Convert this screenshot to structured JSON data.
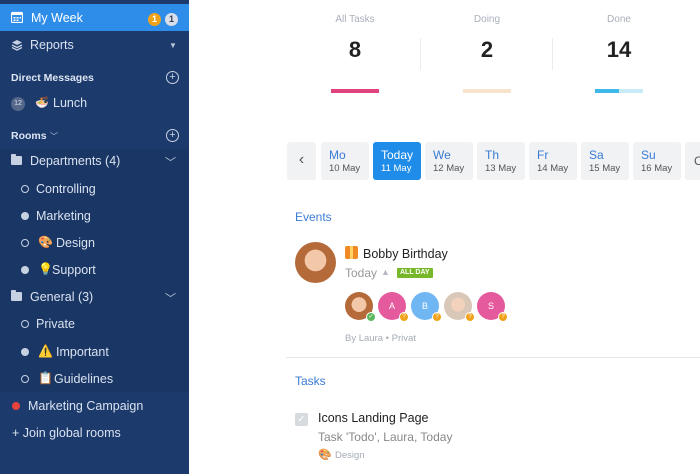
{
  "sidebar": {
    "my_week": {
      "label": "My Week",
      "badge_orange": "1",
      "badge_gray": "1"
    },
    "reports": {
      "label": "Reports"
    },
    "direct_messages": {
      "heading": "Direct Messages",
      "items": [
        {
          "count": "12",
          "emoji": "🍜",
          "label": "Lunch"
        }
      ]
    },
    "rooms": {
      "heading": "Rooms",
      "groups": [
        {
          "label": "Departments (4)",
          "items": [
            {
              "label": "Controlling",
              "status": "open"
            },
            {
              "label": "Marketing",
              "status": "full"
            },
            {
              "label": "Design",
              "status": "open",
              "emoji": "🎨"
            },
            {
              "label": "Support",
              "status": "full",
              "emoji": "💡"
            }
          ]
        },
        {
          "label": "General (3)",
          "items": [
            {
              "label": "Private",
              "status": "open"
            },
            {
              "label": "Important",
              "status": "full",
              "emoji": "⚠️"
            },
            {
              "label": "Guidelines",
              "status": "open",
              "emoji": "📋"
            }
          ]
        }
      ]
    },
    "marketing_campaign": {
      "label": "Marketing Campaign"
    },
    "join_global": {
      "label": "+ Join global rooms"
    }
  },
  "stats": [
    {
      "label": "All Tasks",
      "value": "8",
      "color": "#e0427d"
    },
    {
      "label": "Doing",
      "value": "2",
      "color": "#f7e3c9"
    },
    {
      "label": "Done",
      "value": "14",
      "color": "#3eb8e8",
      "progress": 0.5
    }
  ],
  "calendar": {
    "days": [
      {
        "day": "Mo",
        "date": "10 May"
      },
      {
        "day": "Today",
        "date": "11 May",
        "active": true
      },
      {
        "day": "We",
        "date": "12 May"
      },
      {
        "day": "Th",
        "date": "13 May"
      },
      {
        "day": "Fr",
        "date": "14 May"
      },
      {
        "day": "Sa",
        "date": "15 May"
      },
      {
        "day": "Su",
        "date": "16 May"
      }
    ],
    "prev_icon": "‹",
    "next_label": "C"
  },
  "events": {
    "heading": "Events",
    "item": {
      "title": "Bobby Birthday",
      "when": "Today",
      "allday": "ALL DAY",
      "attendees": [
        {
          "initial": "",
          "color": "#b56a3a",
          "badge_color": "#5cb85c",
          "badge": "✓"
        },
        {
          "initial": "A",
          "color": "#e55a9c",
          "badge_color": "#f0a31a",
          "badge": "?"
        },
        {
          "initial": "B",
          "color": "#6fb6f2",
          "badge_color": "#f0a31a",
          "badge": "?"
        },
        {
          "initial": "",
          "color": "#d9c7b8",
          "badge_color": "#f0a31a",
          "badge": "?"
        },
        {
          "initial": "S",
          "color": "#e55a9c",
          "badge_color": "#f0a31a",
          "badge": "?"
        }
      ],
      "by": "By Laura • Privat"
    }
  },
  "tasks": {
    "heading": "Tasks",
    "item": {
      "title": "Icons Landing Page",
      "subtitle": "Task 'Todo', Laura, Today",
      "room_emoji": "🎨",
      "room": "Design"
    }
  }
}
